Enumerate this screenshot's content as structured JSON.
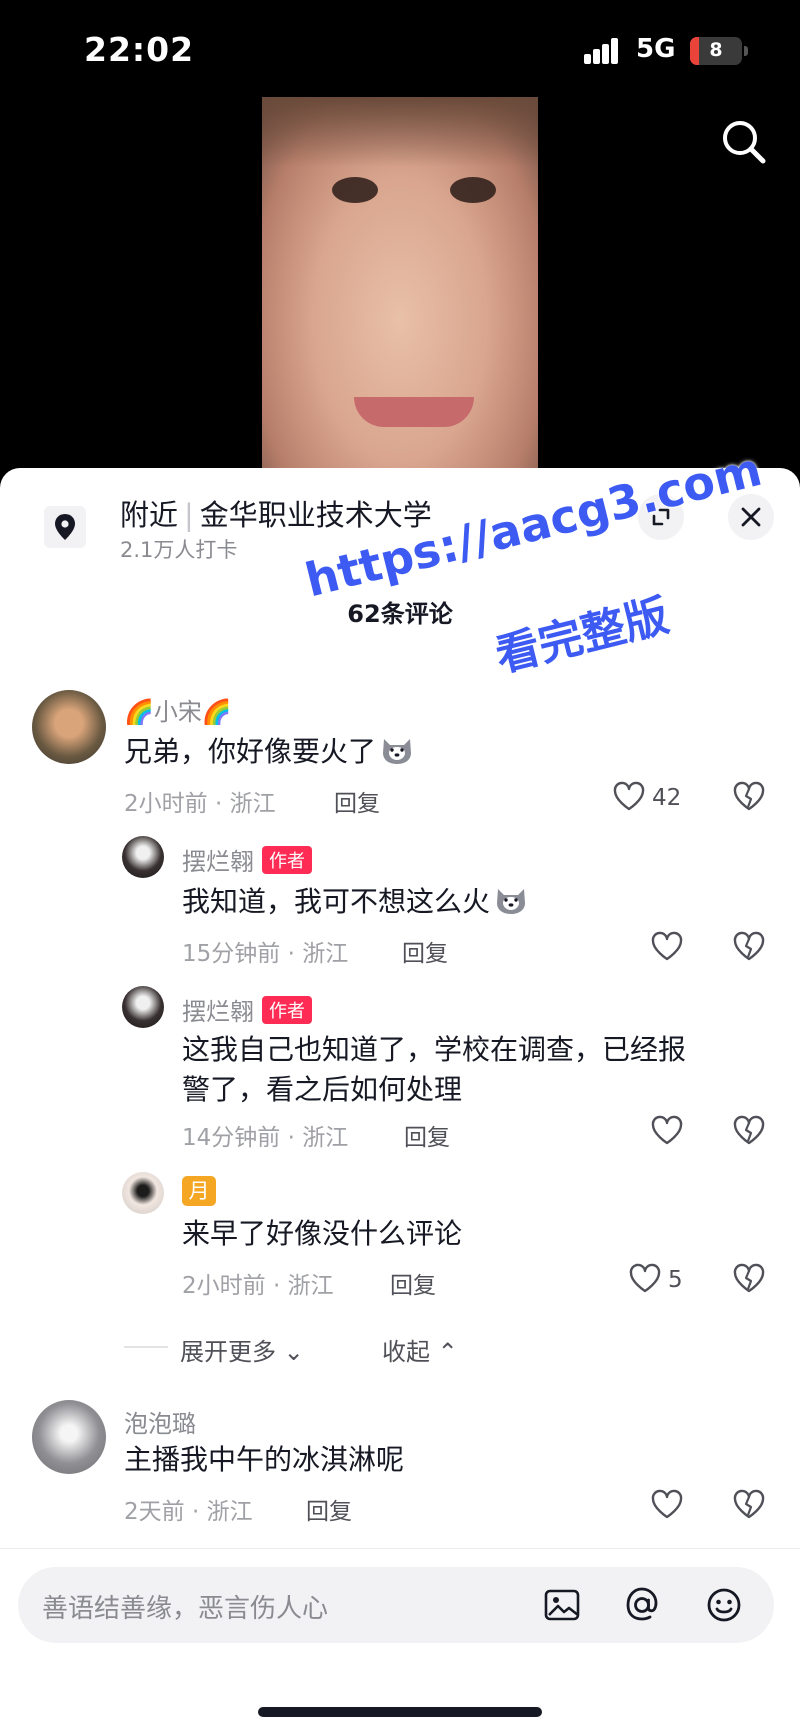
{
  "status": {
    "time": "22:02",
    "network": "5G",
    "battery": "8"
  },
  "colors": {
    "accent": "#fe2c55",
    "watermark": "#3d5bf2",
    "badge_moon": "#f5a623"
  },
  "header": {
    "location_tag": "附近",
    "location_name": "金华职业技术大学",
    "checkins": "2.1万人打卡",
    "comment_count": "62条评论"
  },
  "watermark": {
    "line1": "https://aacg3.com",
    "line2": "看完整版"
  },
  "comments": [
    {
      "user": "🌈小宋🌈",
      "text": "兄弟，你好像要火了",
      "meta": "2小时前 · 浙江",
      "reply": "回复",
      "likes": "42"
    },
    {
      "user": "摆烂翱",
      "badge": "作者",
      "text": "我知道，我可不想这么火",
      "meta": "15分钟前 · 浙江",
      "reply": "回复"
    },
    {
      "user": "摆烂翱",
      "badge": "作者",
      "text1": "这我自己也知道了，学校在调查，已经报",
      "text2": "警了，看之后如何处理",
      "meta": "14分钟前 · 浙江",
      "reply": "回复"
    },
    {
      "badge": "月",
      "text": "来早了好像没什么评论",
      "meta": "2小时前 · 浙江",
      "reply": "回复",
      "likes": "5"
    },
    {
      "user": "泡泡璐",
      "text": "主播我中午的冰淇淋呢",
      "meta": "2天前 · 浙江",
      "reply": "回复"
    }
  ],
  "thread": {
    "expand_more": "展开更多",
    "collapse": "收起"
  },
  "input": {
    "placeholder": "善语结善缘，恶言伤人心"
  },
  "icons": [
    "search-icon",
    "location-pin-icon",
    "expand-icon",
    "close-icon",
    "heart-icon",
    "broken-heart-icon",
    "image-icon",
    "at-icon",
    "emoji-icon"
  ]
}
